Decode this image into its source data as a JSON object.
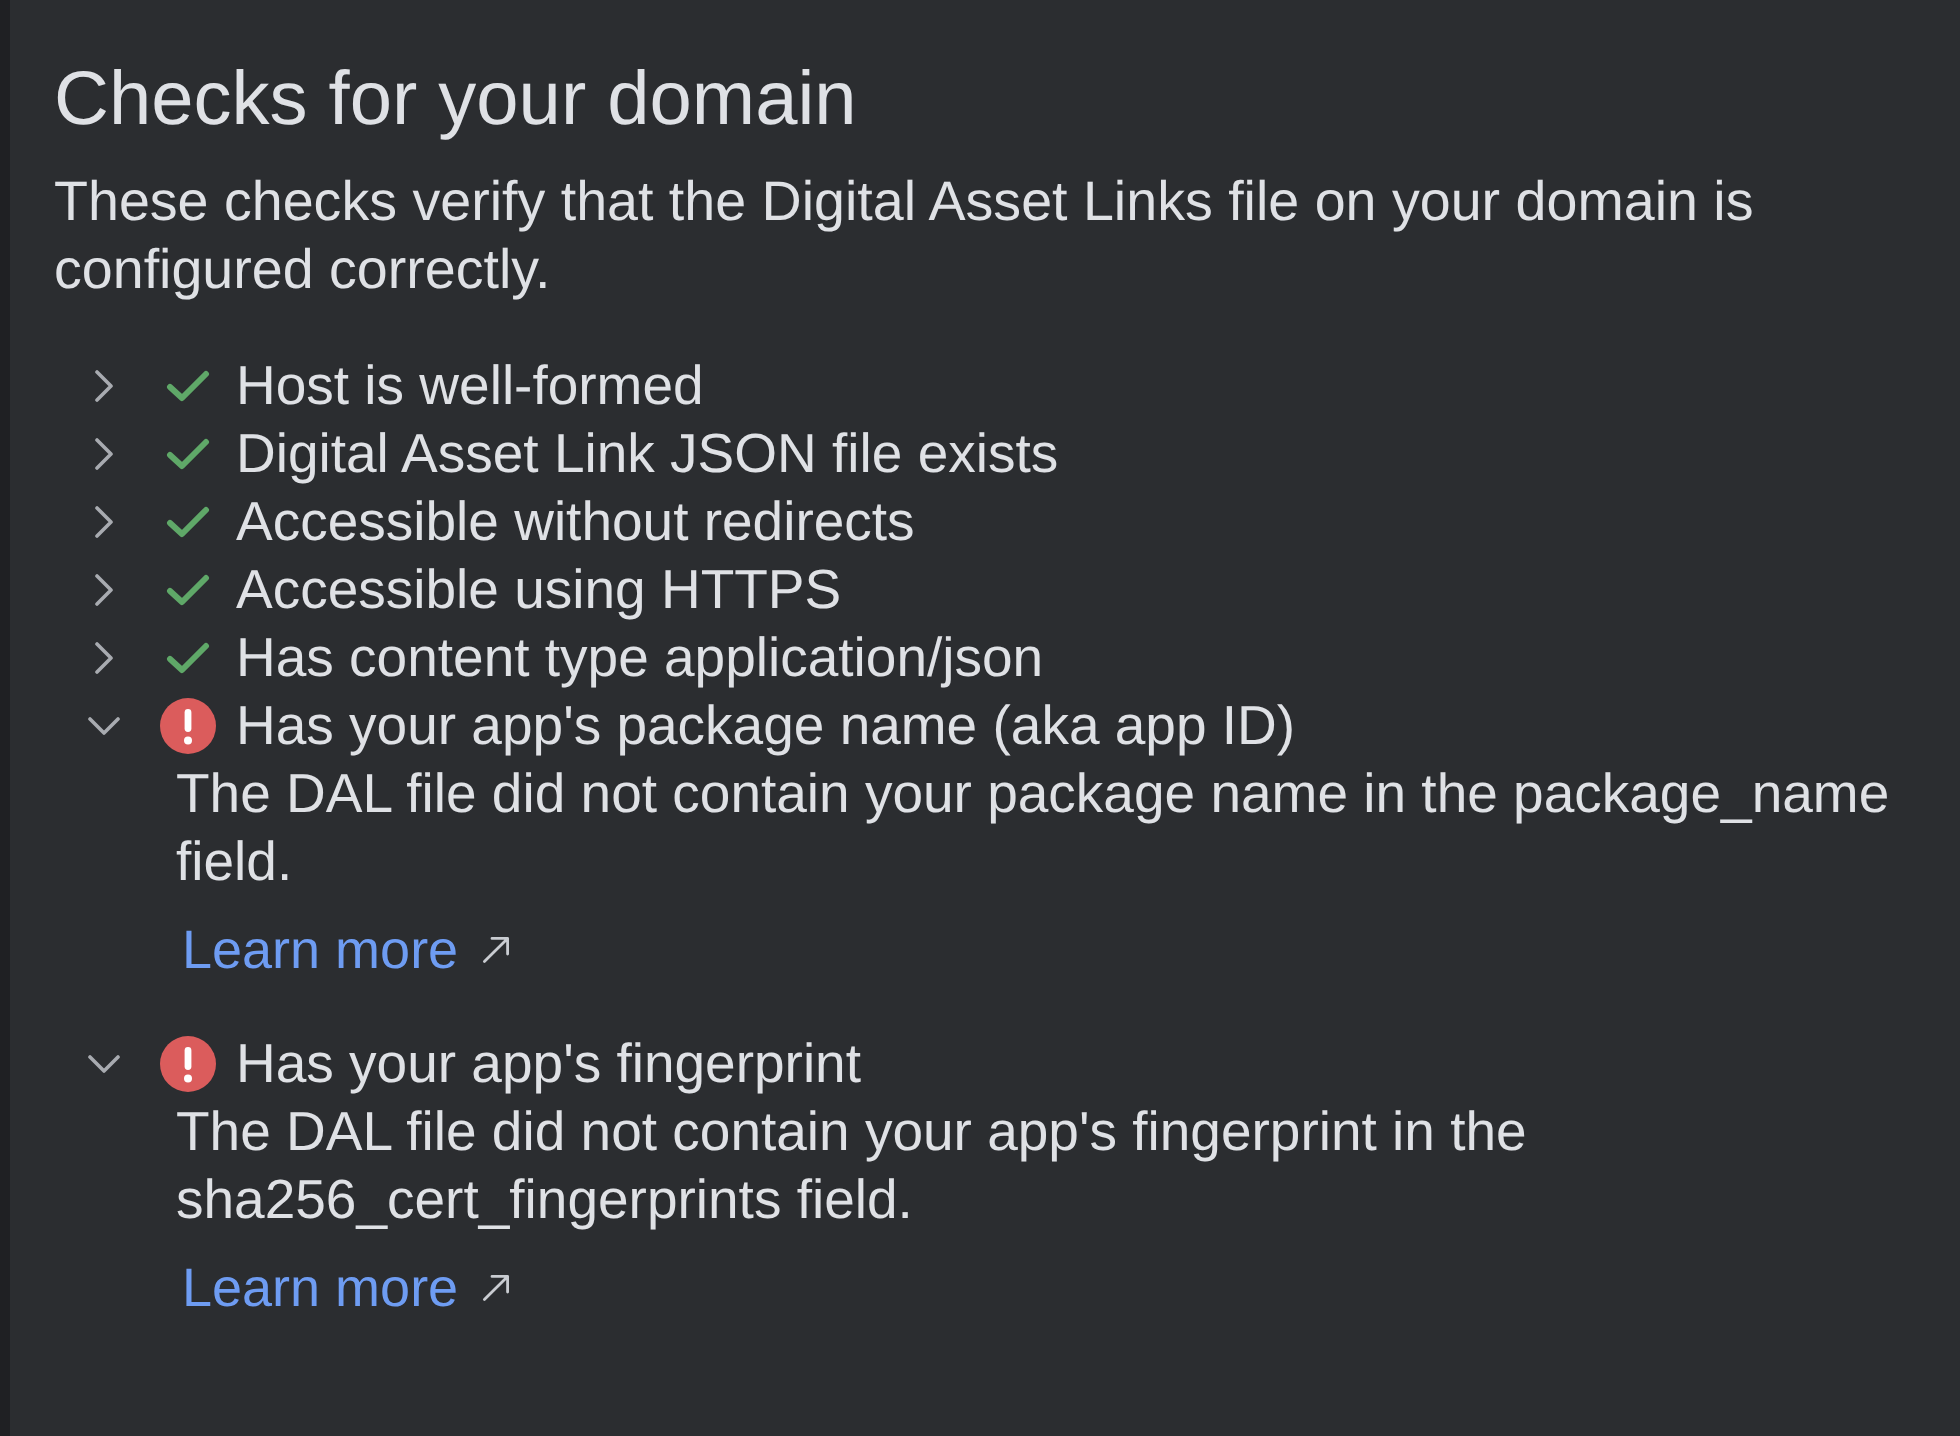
{
  "title": "Checks for your domain",
  "description": "These checks verify that the Digital Asset Links file on your domain is configured correctly.",
  "checks": [
    {
      "label": "Host is well-formed",
      "kind": "pass",
      "expanded": false
    },
    {
      "label": "Digital Asset Link JSON file exists",
      "kind": "pass",
      "expanded": false
    },
    {
      "label": "Accessible without redirects",
      "kind": "pass",
      "expanded": false
    },
    {
      "label": "Accessible using HTTPS",
      "kind": "pass",
      "expanded": false
    },
    {
      "label": "Has content type application/json",
      "kind": "pass",
      "expanded": false
    },
    {
      "label": "Has your app's package name (aka app ID)",
      "kind": "error",
      "expanded": true,
      "message": "The DAL file did not contain your package name in the package_name field.",
      "link": "Learn more"
    },
    {
      "label": "Has your app's fingerprint",
      "kind": "error",
      "expanded": true,
      "message": "The DAL file did not contain your app's fingerprint in the sha256_cert_fingerprints field.",
      "link": "Learn more"
    }
  ]
}
